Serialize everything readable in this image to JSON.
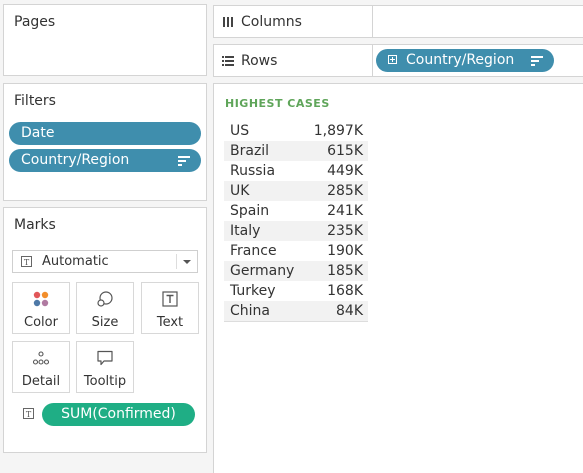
{
  "pages": {
    "title": "Pages"
  },
  "filters": {
    "title": "Filters",
    "pills": [
      "Date",
      "Country/Region"
    ]
  },
  "marks": {
    "title": "Marks",
    "type_dropdown": "Automatic",
    "cards": [
      "Color",
      "Size",
      "Text",
      "Detail",
      "Tooltip"
    ],
    "measure_pill": "SUM(Confirmed)"
  },
  "shelves": {
    "columns_label": "Columns",
    "rows_label": "Rows",
    "rows_pill": "Country/Region"
  },
  "view": {
    "title": "HIGHEST CASES",
    "rows": [
      {
        "country": "US",
        "value": "1,897K"
      },
      {
        "country": "Brazil",
        "value": "615K"
      },
      {
        "country": "Russia",
        "value": "449K"
      },
      {
        "country": "UK",
        "value": "285K"
      },
      {
        "country": "Spain",
        "value": "241K"
      },
      {
        "country": "Italy",
        "value": "235K"
      },
      {
        "country": "France",
        "value": "190K"
      },
      {
        "country": "Germany",
        "value": "185K"
      },
      {
        "country": "Turkey",
        "value": "168K"
      },
      {
        "country": "China",
        "value": "84K"
      }
    ]
  },
  "colors": {
    "dimension_pill": "#3f8ead",
    "measure_pill": "#1fae85",
    "title_green": "#5fa55a"
  }
}
